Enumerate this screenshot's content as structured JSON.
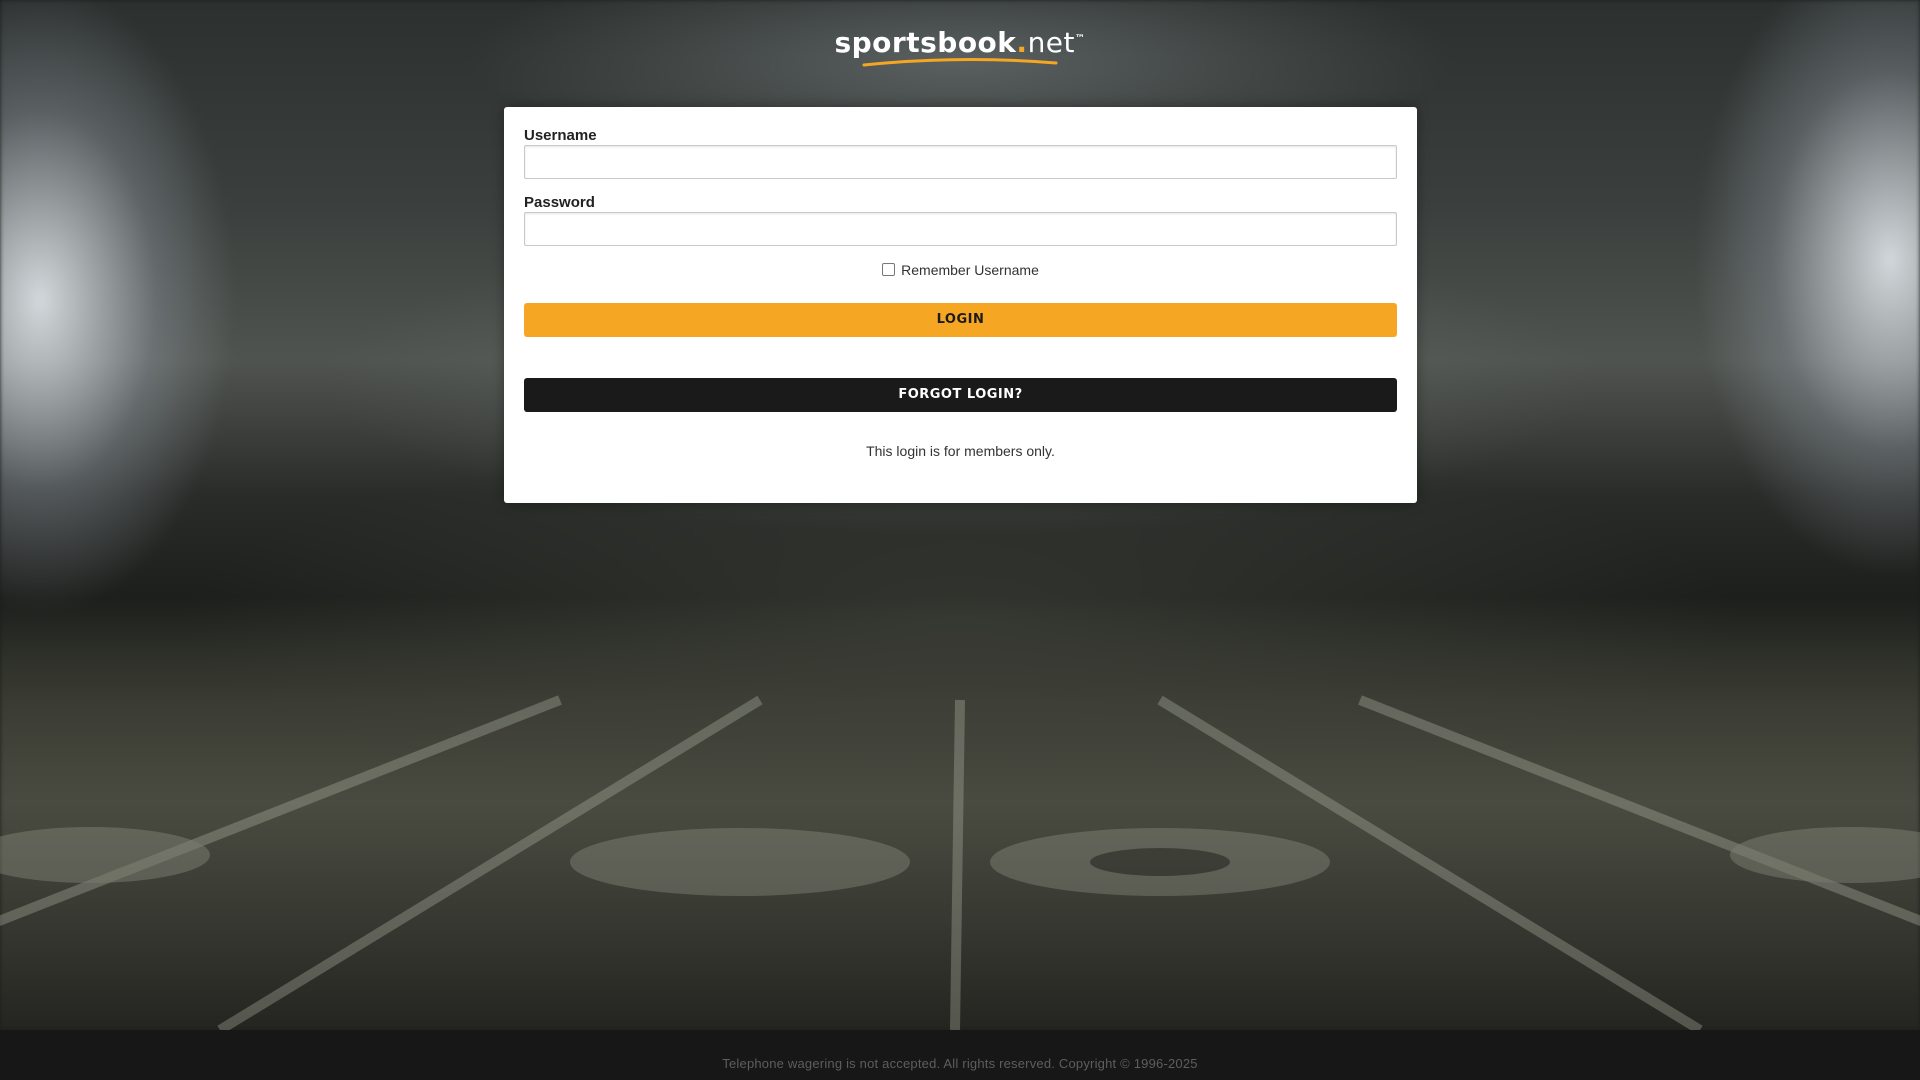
{
  "brand": {
    "name": "sportsbook",
    "dot": ".",
    "tld": "net",
    "trademark": "™"
  },
  "login_form": {
    "username_label": "Username",
    "username_value": "",
    "password_label": "Password",
    "password_value": "",
    "remember_label": "Remember Username",
    "remember_checked": false,
    "login_button": "LOGIN",
    "forgot_button": "FORGOT LOGIN?",
    "members_note": "This login is for members only."
  },
  "footer": {
    "text": "Telephone wagering is not accepted. All rights reserved. Copyright © 1996-2025"
  },
  "colors": {
    "accent": "#f5a623",
    "dark_button": "#1a1a1a",
    "card_background": "#ffffff"
  }
}
